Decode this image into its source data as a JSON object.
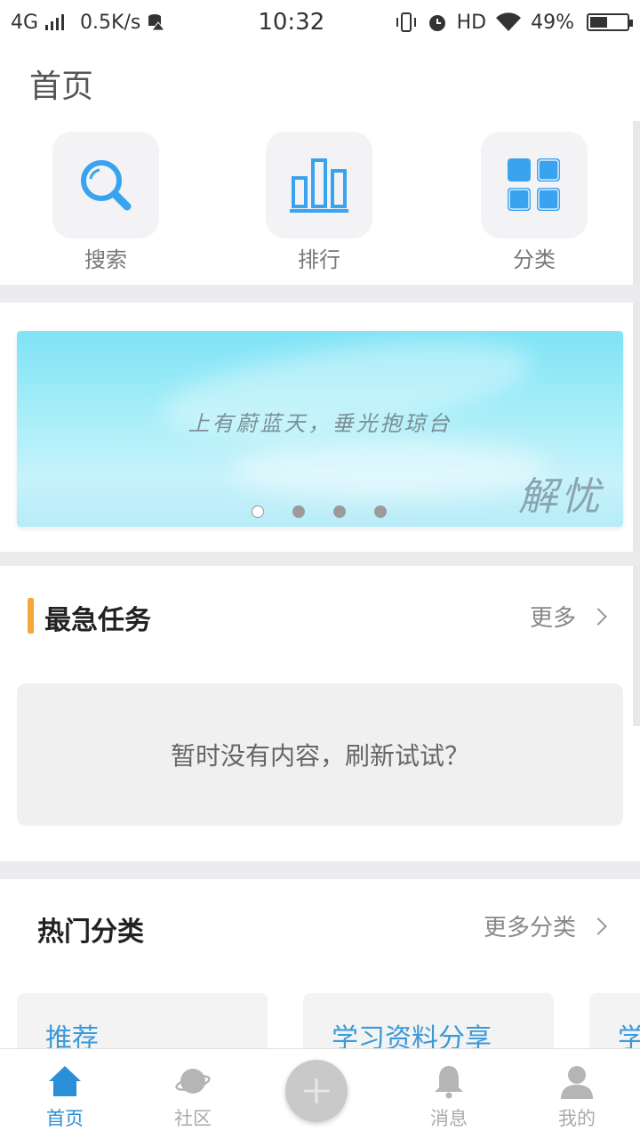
{
  "status_bar": {
    "network": "4G",
    "speed": "0.5K/s",
    "time": "10:32",
    "hd": "HD",
    "battery": "49%",
    "battery_level": 0.49
  },
  "page": {
    "title": "首页"
  },
  "quick_actions": [
    {
      "label": "搜索",
      "icon": "search-icon"
    },
    {
      "label": "排行",
      "icon": "bar-chart-icon"
    },
    {
      "label": "分类",
      "icon": "grid-icon"
    }
  ],
  "banner": {
    "slogan": "上有蔚蓝天，垂光抱琼台",
    "signature": "解忧",
    "dot_count": 4,
    "active_dot": 0
  },
  "urgent_tasks": {
    "title": "最急任务",
    "more_label": "更多",
    "empty_text": "暂时没有内容，刷新试试？"
  },
  "hot_categories": {
    "title": "热门分类",
    "more_label": "更多分类",
    "items": [
      "推荐",
      "学习资料分享",
      "学"
    ]
  },
  "bottom_nav": {
    "items": [
      {
        "label": "首页",
        "icon": "home-icon",
        "active": true
      },
      {
        "label": "社区",
        "icon": "planet-icon",
        "active": false
      },
      {
        "label": "消息",
        "icon": "bell-icon",
        "active": false
      },
      {
        "label": "我的",
        "icon": "user-icon",
        "active": false
      }
    ],
    "fab_icon": "plus-icon"
  },
  "colors": {
    "accent_blue": "#3aa3f0",
    "nav_active": "#2a8fd6",
    "section_accent": "#f6a73a"
  }
}
